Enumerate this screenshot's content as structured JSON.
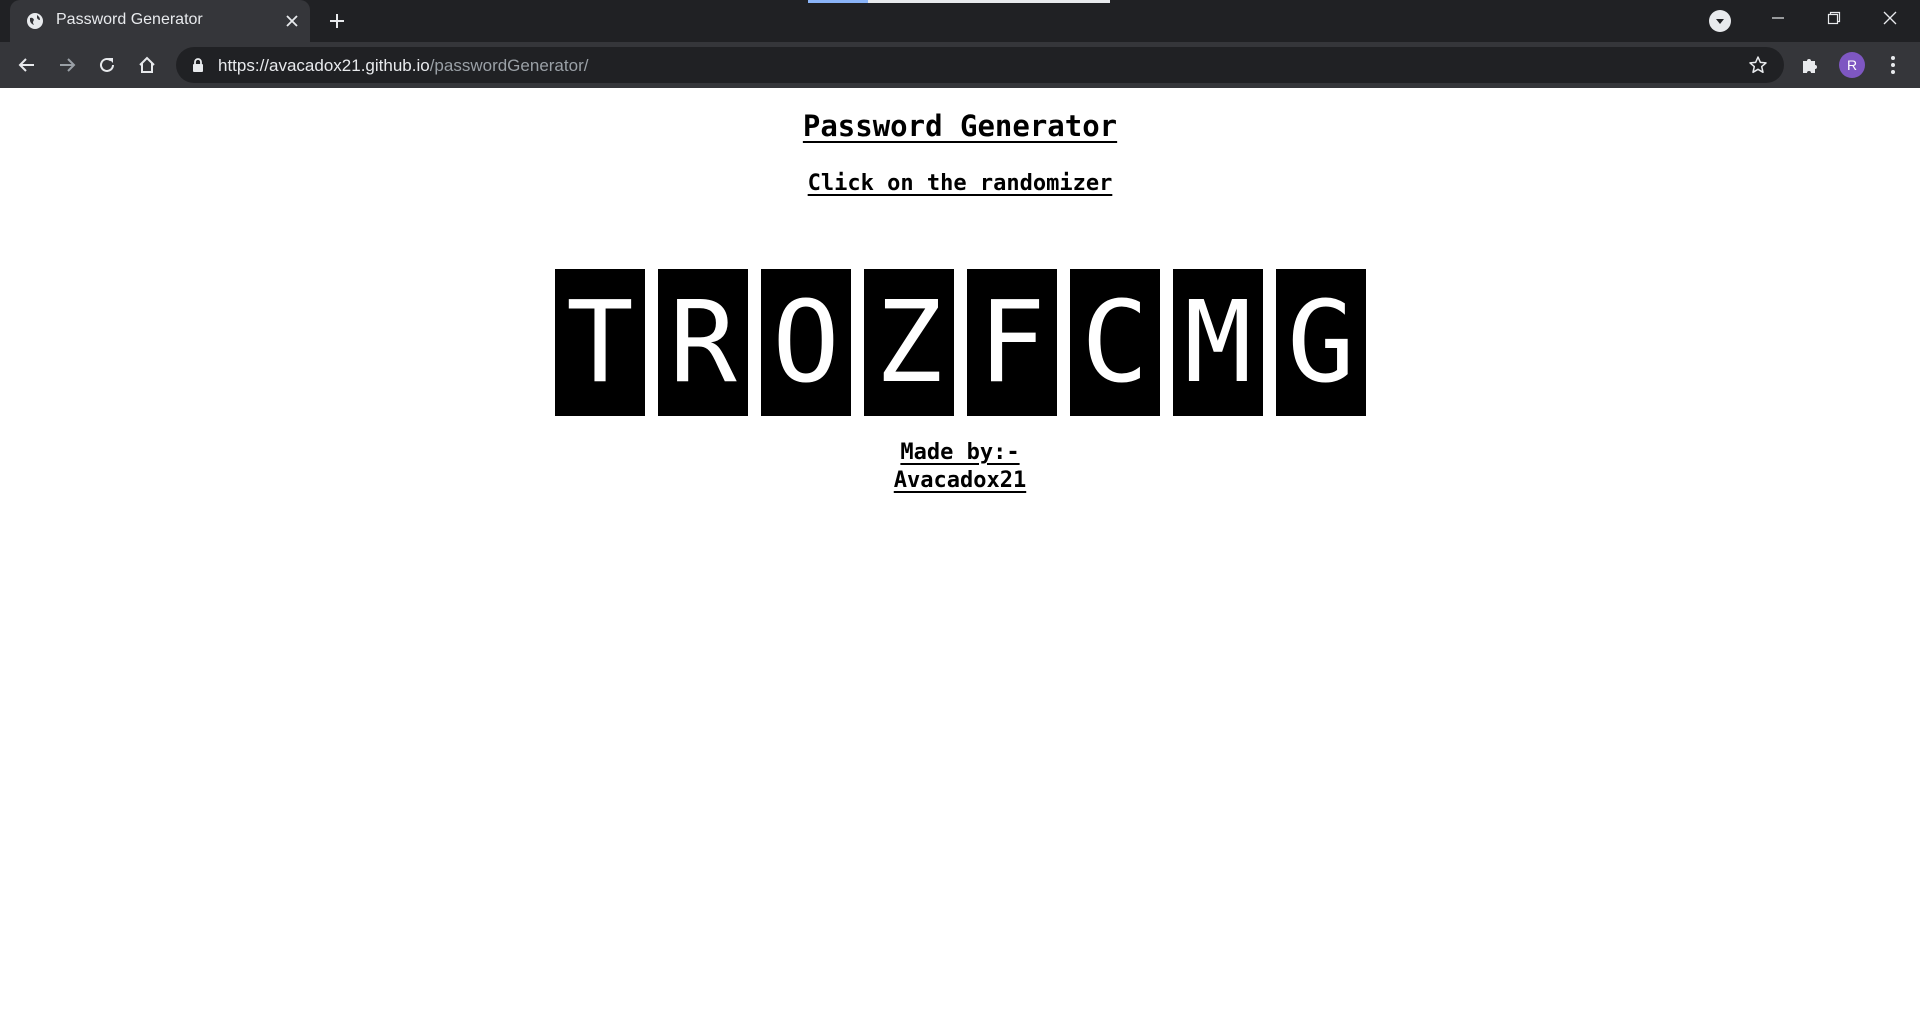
{
  "browser": {
    "tab": {
      "title": "Password Generator",
      "favicon": "globe-icon",
      "close_icon": "close-icon"
    },
    "new_tab_icon": "plus-icon",
    "tab_search_icon": "chevron-down-icon",
    "window_controls": [
      "minimize-icon",
      "restore-icon",
      "close-icon"
    ],
    "nav": {
      "back_icon": "arrow-left-icon",
      "forward_icon": "arrow-right-icon",
      "reload_icon": "reload-icon",
      "home_icon": "home-icon"
    },
    "address_bar": {
      "host": "https://avacadox21.github.io",
      "path": "/passwordGenerator/",
      "lock_icon": "lock-icon",
      "bookmark_icon": "star-icon"
    },
    "extensions_icon": "puzzle-icon",
    "profile": {
      "initial": "R",
      "color": "#7e57c2"
    },
    "menu_icon": "more-vertical-icon"
  },
  "page": {
    "title": "Password Generator",
    "subtitle": "Click on the randomizer",
    "password_chars": [
      "T",
      "R",
      "O",
      "Z",
      "F",
      "C",
      "M",
      "G"
    ],
    "credit_line1": "Made by:-",
    "credit_line2": "Avacadox21"
  },
  "colors": {
    "chrome_dark": "#202124",
    "chrome_toolbar": "#35363a",
    "char_box_bg": "#000000",
    "char_box_fg": "#ffffff",
    "page_bg": "#ffffff"
  }
}
